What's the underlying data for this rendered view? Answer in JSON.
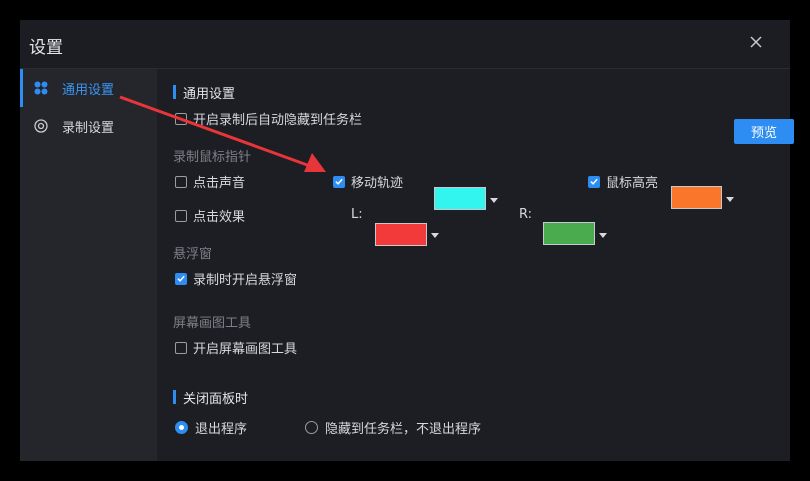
{
  "window": {
    "title": "设置"
  },
  "sidebar": {
    "items": [
      {
        "label": "通用设置",
        "icon": "grid-icon",
        "active": true
      },
      {
        "label": "录制设置",
        "icon": "record-icon",
        "active": false
      }
    ]
  },
  "general": {
    "heading": "通用设置",
    "auto_hide_label": "开启录制后自动隐藏到任务栏",
    "preview_label": "预览"
  },
  "mouse": {
    "group_label": "录制鼠标指针",
    "click_sound_label": "点击声音",
    "move_track_label": "移动轨迹",
    "move_track_color": "#33f5f0",
    "highlight_label": "鼠标高亮",
    "highlight_color": "#f9762a",
    "click_effect_label": "点击效果",
    "left_label": "L:",
    "left_color": "#f23a3a",
    "right_label": "R:",
    "right_color": "#4aab4e"
  },
  "float_window": {
    "group_label": "悬浮窗",
    "enable_label": "录制时开启悬浮窗"
  },
  "draw_tool": {
    "group_label": "屏幕画图工具",
    "enable_label": "开启屏幕画图工具"
  },
  "close_panel": {
    "heading": "关闭面板时",
    "option_exit": "退出程序",
    "option_hide": "隐藏到任务栏，不退出程序"
  },
  "colors": {
    "accent": "#2e8df3",
    "annotation_arrow": "#e8353a"
  }
}
